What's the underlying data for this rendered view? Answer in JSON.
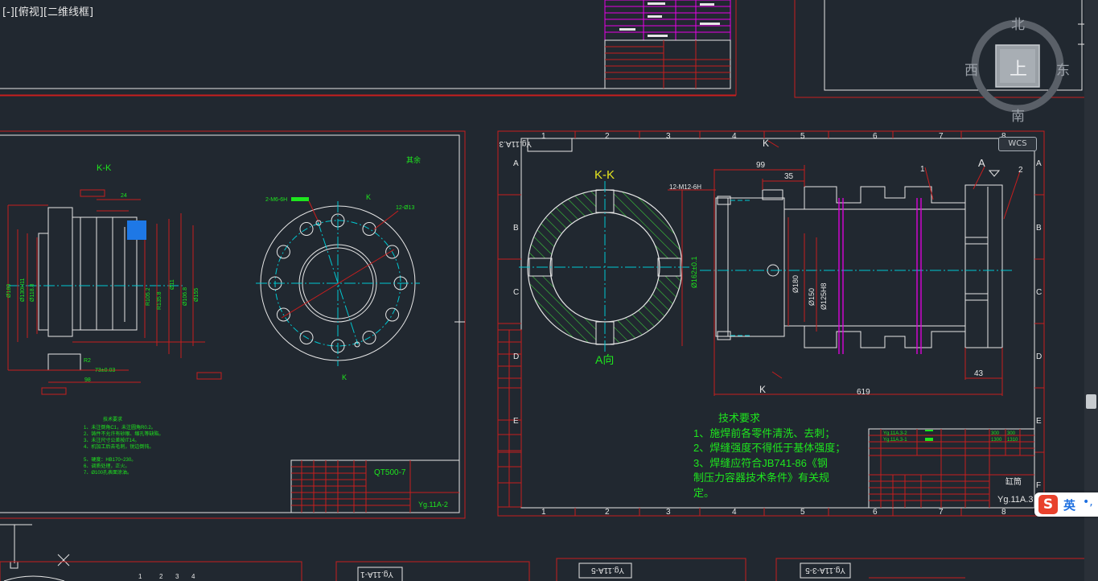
{
  "viewport": {
    "label": "[-][俯视][二维线框]"
  },
  "viewcube": {
    "north": "北",
    "south": "南",
    "east": "东",
    "west": "西",
    "top_face": "上",
    "wcs_label": "WCS"
  },
  "colors": {
    "background": "#212830",
    "frame_red": "#c81e1e",
    "line_white": "#e6e6e6",
    "center_cyan": "#00c8d2",
    "text_green": "#1ee61e",
    "text_yellow": "#e6e61e",
    "hatch_green": "#3cc83c",
    "magenta": "#e600e6"
  },
  "main_drawing": {
    "section_label": "K-K",
    "view_label": "A向",
    "section_marker": "K",
    "label_a": "A",
    "dims": {
      "length_total": "619",
      "d99": "99",
      "d35": "35",
      "d43": "43",
      "thread": "12-M12-6H",
      "dia_162": "Ø162±0.1",
      "dia_180": "Ø180",
      "dia_150": "Ø150",
      "dia_125": "Ø125H8",
      "leader_1": "1",
      "leader_2": "2"
    },
    "grid_numbers": [
      "1",
      "2",
      "3",
      "4",
      "5",
      "6",
      "7",
      "8"
    ],
    "grid_letters": [
      "A",
      "B",
      "C",
      "D",
      "E",
      "F"
    ],
    "drawing_no": "Yg.11A.3",
    "drawing_no_mirrored": "Yg.11A.3",
    "part_name": "缸筒",
    "tech_title": "技术要求",
    "tech_lines": [
      "1、施焊前各零件清洗、去刺；",
      "2、焊缝强度不得低于基体强度；",
      "3、焊缝应符合JB741-86《钢",
      "   制压力容器技术条件》有关规",
      "定。"
    ],
    "bom_items": [
      "Yg.11A.3-2",
      "Yg.11A.3-1"
    ],
    "bom_values": [
      "300",
      "300",
      "1300",
      "1310"
    ]
  },
  "left_drawing": {
    "section_label": "K-K",
    "corner_note": "其余",
    "thread_label": "2-M6-6H",
    "hole_label": "12-Ø13",
    "marker_k": "K",
    "dims": {
      "d24": "24",
      "d73": "73±0.03",
      "d98": "98",
      "r2": "R2"
    },
    "tech_title": "技术要求",
    "tech_lines": [
      "1、未注倒角C1，未注圆角R0.2。",
      "2、铸件不允许有砂眼、缩孔等缺陷。",
      "3、未注尺寸公差按IT14。",
      "4、机加工后去毛刺，锐边倒钝。",
      "5、硬度：HB170~230。",
      "6、调质处理，正火。",
      "7、Ø100孔表面涂油。"
    ],
    "material": "QT500-7",
    "drawing_no": "Yg.11A-2"
  },
  "bottom_sheets": {
    "sheet_1": "Yg.11A-1",
    "sheet_2": "Yg.11A-5",
    "sheet_3": "Yg.11A-3-5",
    "scale_numbers": [
      "1",
      "2",
      "3",
      "4"
    ]
  },
  "ime": {
    "logo": "S",
    "mode": "英",
    "dot": "•,"
  }
}
